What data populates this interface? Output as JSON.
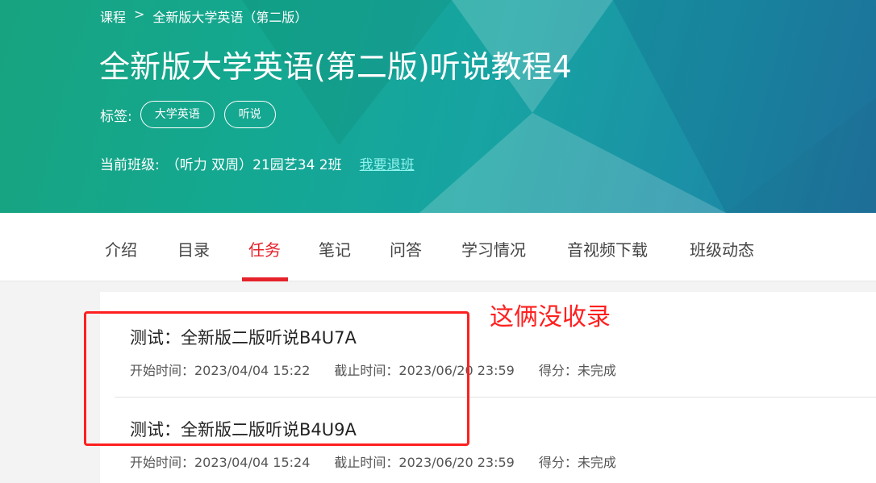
{
  "breadcrumb": {
    "root": "课程",
    "separator": ">",
    "current": "全新版大学英语（第二版）"
  },
  "course": {
    "title": "全新版大学英语(第二版)听说教程4"
  },
  "tags": {
    "label": "标签:",
    "items": [
      "大学英语",
      "听说"
    ]
  },
  "current_class": {
    "label": "当前班级:",
    "name": "（听力 双周）21园艺34 2班",
    "quit_link": "我要退班"
  },
  "nav": {
    "tabs": [
      "介绍",
      "目录",
      "任务",
      "笔记",
      "问答",
      "学习情况",
      "音视频下载",
      "班级动态"
    ],
    "active": "任务"
  },
  "tasks": [
    {
      "title": "测试：全新版二版听说B4U7A",
      "start": "开始时间：2023/04/04 15:22",
      "deadline": "截止时间：2023/06/20 23:59",
      "score": "得分：未完成"
    },
    {
      "title": "测试：全新版二版听说B4U9A",
      "start": "开始时间：2023/04/04 15:24",
      "deadline": "截止时间：2023/06/20 23:59",
      "score": "得分：未完成"
    }
  ],
  "annotation": {
    "text": "这俩没收录",
    "color": "#ff1f1f"
  },
  "colors": {
    "accent": "#e5222a",
    "hero_start": "#17a37f",
    "hero_end": "#2379a3"
  }
}
